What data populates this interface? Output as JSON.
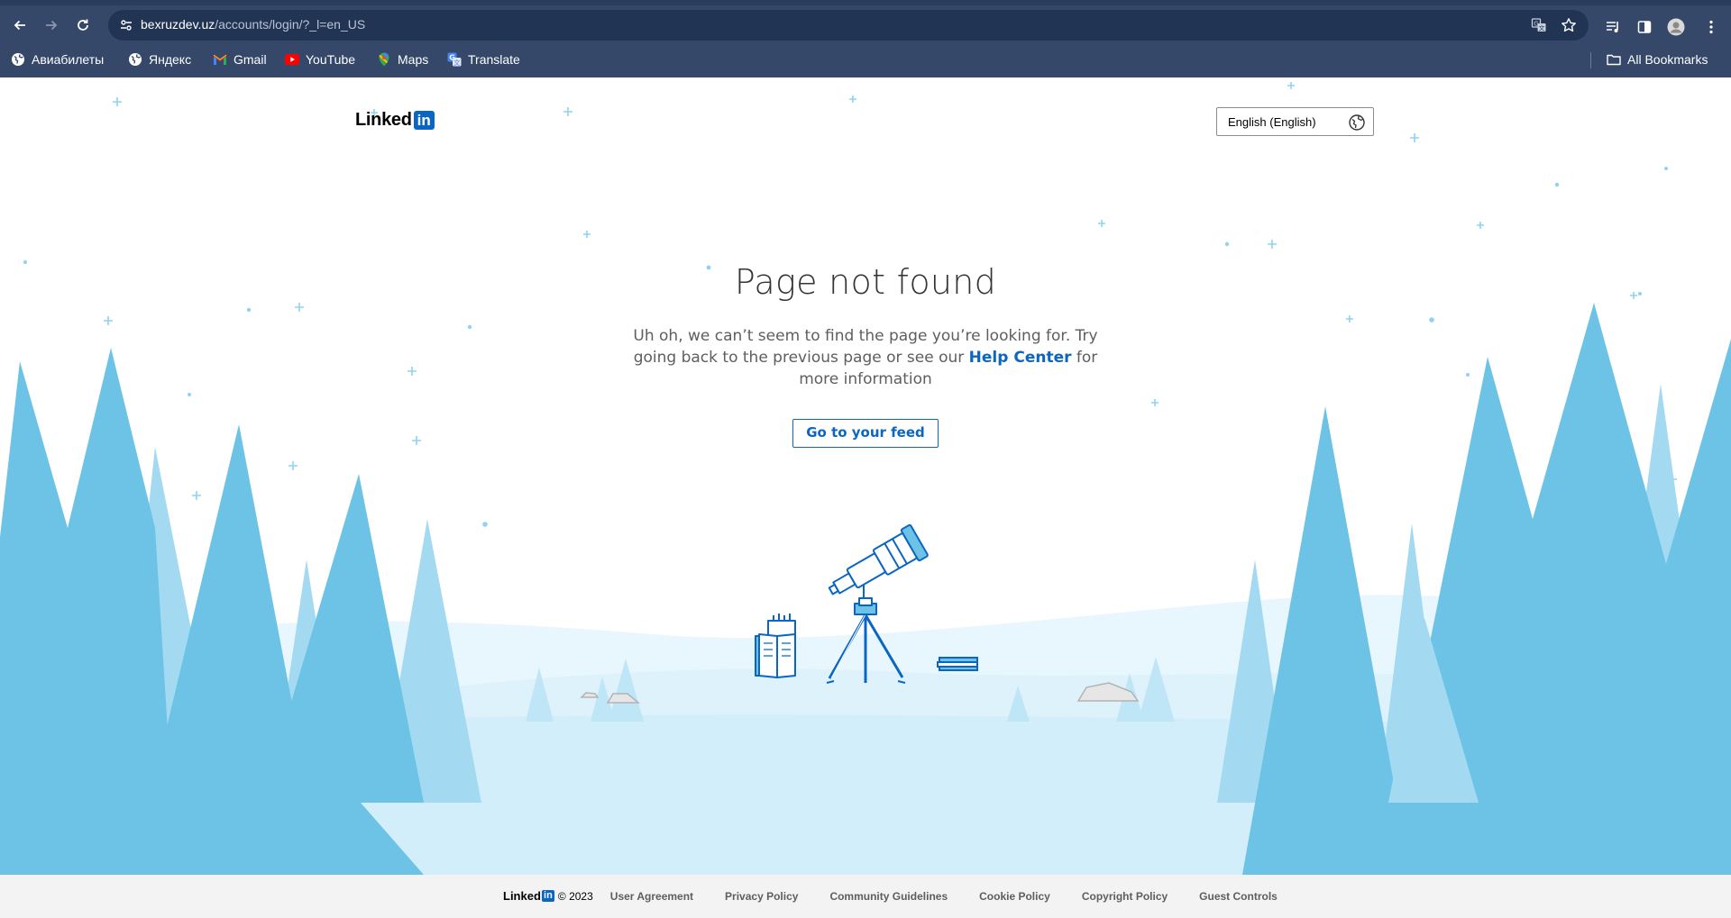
{
  "browser": {
    "url_host": "bexruzdev.uz",
    "url_path": "/accounts/login/?_l=en_US",
    "bookmarks": [
      {
        "label": "Авиабилеты",
        "icon": "globe-icon"
      },
      {
        "label": "Яндекс",
        "icon": "globe-icon"
      },
      {
        "label": "Gmail",
        "icon": "gmail-icon"
      },
      {
        "label": "YouTube",
        "icon": "youtube-icon"
      },
      {
        "label": "Maps",
        "icon": "maps-icon"
      },
      {
        "label": "Translate",
        "icon": "translate-icon"
      }
    ],
    "all_bookmarks": "All Bookmarks",
    "colors": {
      "frame": "#35486a",
      "omnibox": "#223454"
    }
  },
  "header": {
    "brand_word": "Linked",
    "brand_box": "in",
    "language": "English (English)"
  },
  "main": {
    "title": "Page not found",
    "message_before": "Uh oh, we can’t seem to find the page you’re looking for. Try going back to the previous page or see our ",
    "help_link": "Help Center",
    "message_after": " for more information",
    "feed_button": "Go to your feed"
  },
  "footer": {
    "brand_word": "Linked",
    "brand_box": "in",
    "copyright": "© 2023",
    "links": [
      "User Agreement",
      "Privacy Policy",
      "Community Guidelines",
      "Cookie Policy",
      "Copyright Policy",
      "Guest Controls"
    ]
  },
  "theme": {
    "linkedin_blue": "#0a66c2",
    "tree_dark": "#6cc3e6",
    "tree_light": "#a3daf2",
    "snow": "#d3eefb"
  }
}
